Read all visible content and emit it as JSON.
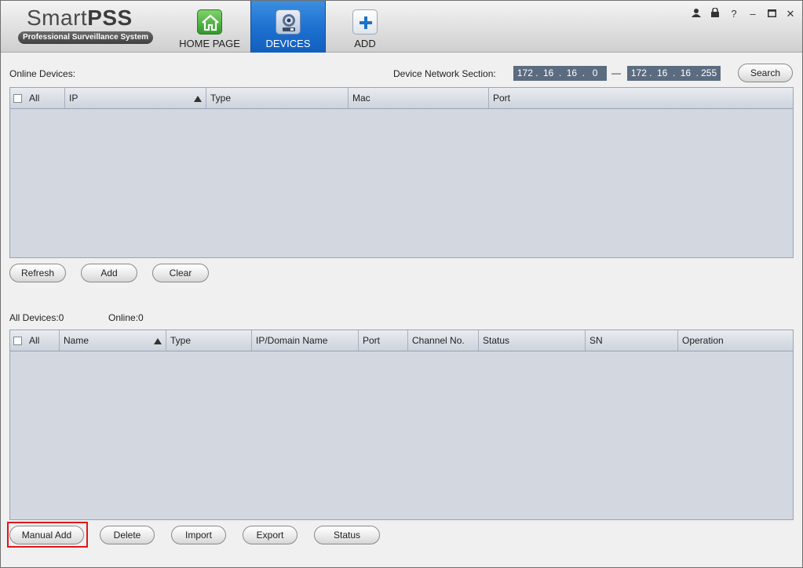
{
  "header": {
    "logo_text_normal": "Smart",
    "logo_text_bold": "PSS",
    "logo_subtitle": "Professional Surveillance System",
    "tabs": [
      {
        "label": "HOME PAGE",
        "icon": "home-icon"
      },
      {
        "label": "DEVICES",
        "icon": "devices-icon",
        "active": true
      },
      {
        "label": "ADD",
        "icon": "add-icon"
      }
    ],
    "window_controls": {
      "user": "👤",
      "lock": "🔒",
      "help": "?",
      "minimize": "–",
      "maximize": "□",
      "close": "✕"
    }
  },
  "online": {
    "title": "Online Devices:",
    "network_label": "Device Network Section:",
    "ip_start": [
      "172",
      "16",
      "16",
      "0"
    ],
    "ip_end": [
      "172",
      "16",
      "16",
      "255"
    ],
    "dash": "—",
    "search_label": "Search",
    "columns": [
      "All",
      "IP",
      "Type",
      "Mac",
      "Port"
    ],
    "buttons": {
      "refresh": "Refresh",
      "add": "Add",
      "clear": "Clear"
    }
  },
  "all_devices": {
    "count_label": "All Devices:0",
    "online_label": "Online:0",
    "columns": [
      "All",
      "Name",
      "Type",
      "IP/Domain Name",
      "Port",
      "Channel No.",
      "Status",
      "SN",
      "Operation"
    ],
    "buttons": {
      "manual_add": "Manual Add",
      "delete": "Delete",
      "import": "Import",
      "export": "Export",
      "status": "Status"
    }
  },
  "colors": {
    "active_tab": "#1c6fd0",
    "table_body": "#d2d7e0",
    "ip_box": "#5c6c80",
    "highlight": "#e0161b"
  }
}
